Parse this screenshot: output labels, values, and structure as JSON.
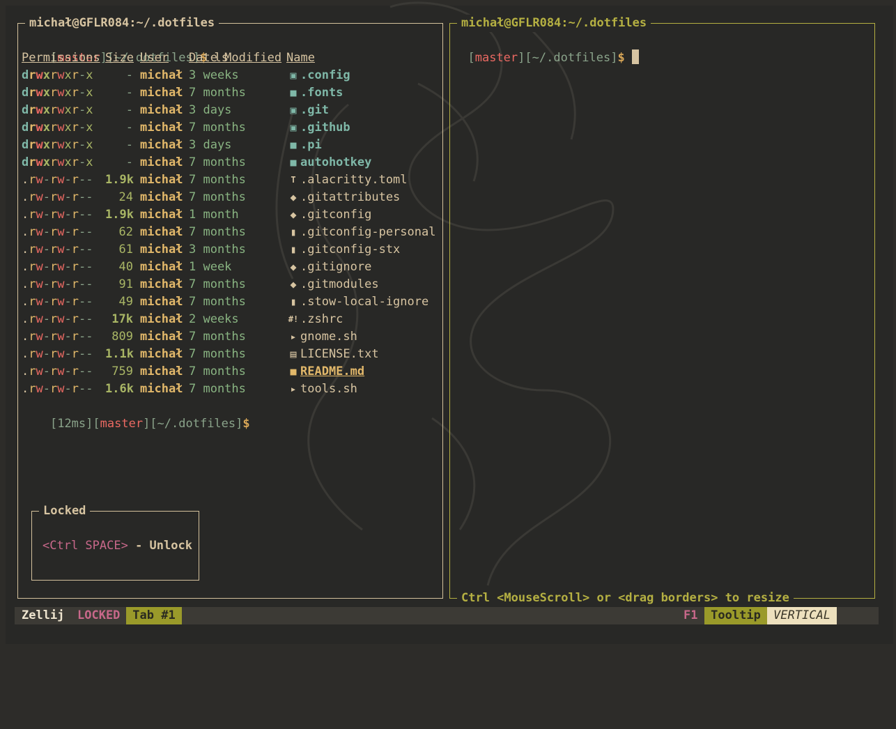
{
  "left_pane": {
    "title": "michał@GFLR084:~/.dotfiles",
    "prompt1": {
      "branch": "master",
      "path": "~/.dotfiles",
      "symbol": "$",
      "command": "ls"
    },
    "headers": [
      "Permissions",
      "Size",
      "User",
      "Date Modified",
      "Name"
    ],
    "rows": [
      {
        "type": "d",
        "perm": "rwxrwxr-x",
        "size": "-",
        "user": "michał",
        "date": "3 weeks",
        "name": ".config",
        "icon": "folder-gear-icon",
        "kind": "dir"
      },
      {
        "type": "d",
        "perm": "rwxrwxr-x",
        "size": "-",
        "user": "michał",
        "date": "7 months",
        "name": ".fonts",
        "icon": "folder-icon",
        "kind": "dir"
      },
      {
        "type": "d",
        "perm": "rwxrwxr-x",
        "size": "-",
        "user": "michał",
        "date": "3 days",
        "name": ".git",
        "icon": "folder-git-icon",
        "kind": "dir"
      },
      {
        "type": "d",
        "perm": "rwxrwxr-x",
        "size": "-",
        "user": "michał",
        "date": "7 months",
        "name": ".github",
        "icon": "folder-github-icon",
        "kind": "dir"
      },
      {
        "type": "d",
        "perm": "rwxrwxr-x",
        "size": "-",
        "user": "michał",
        "date": "3 days",
        "name": ".pi",
        "icon": "folder-icon",
        "kind": "dir"
      },
      {
        "type": "d",
        "perm": "rwxrwxr-x",
        "size": "-",
        "user": "michał",
        "date": "7 months",
        "name": "autohotkey",
        "icon": "folder-icon",
        "kind": "dir"
      },
      {
        "type": ".",
        "perm": "rw-rw-r--",
        "size": "1.9k",
        "user": "michał",
        "date": "7 months",
        "name": ".alacritty.toml",
        "icon": "toml-icon",
        "kind": "file"
      },
      {
        "type": ".",
        "perm": "rw-rw-r--",
        "size": "24",
        "user": "michał",
        "date": "7 months",
        "name": ".gitattributes",
        "icon": "git-icon",
        "kind": "file"
      },
      {
        "type": ".",
        "perm": "rw-rw-r--",
        "size": "1.9k",
        "user": "michał",
        "date": "1 month",
        "name": ".gitconfig",
        "icon": "git-icon",
        "kind": "file"
      },
      {
        "type": ".",
        "perm": "rw-rw-r--",
        "size": "62",
        "user": "michał",
        "date": "7 months",
        "name": ".gitconfig-personal",
        "icon": "file-icon",
        "kind": "file"
      },
      {
        "type": ".",
        "perm": "rw-rw-r--",
        "size": "61",
        "user": "michał",
        "date": "3 months",
        "name": ".gitconfig-stx",
        "icon": "file-icon",
        "kind": "file"
      },
      {
        "type": ".",
        "perm": "rw-rw-r--",
        "size": "40",
        "user": "michał",
        "date": "1 week",
        "name": ".gitignore",
        "icon": "git-icon",
        "kind": "file"
      },
      {
        "type": ".",
        "perm": "rw-rw-r--",
        "size": "91",
        "user": "michał",
        "date": "7 months",
        "name": ".gitmodules",
        "icon": "git-icon",
        "kind": "file"
      },
      {
        "type": ".",
        "perm": "rw-rw-r--",
        "size": "49",
        "user": "michał",
        "date": "7 months",
        "name": ".stow-local-ignore",
        "icon": "file-icon",
        "kind": "file"
      },
      {
        "type": ".",
        "perm": "rw-rw-r--",
        "size": "17k",
        "user": "michał",
        "date": "2 weeks",
        "name": ".zshrc",
        "icon": "shebang-icon",
        "kind": "file"
      },
      {
        "type": ".",
        "perm": "rw-rw-r--",
        "size": "809",
        "user": "michał",
        "date": "7 months",
        "name": "gnome.sh",
        "icon": "terminal-icon",
        "kind": "file"
      },
      {
        "type": ".",
        "perm": "rw-rw-r--",
        "size": "1.1k",
        "user": "michał",
        "date": "7 months",
        "name": "LICENSE.txt",
        "icon": "book-icon",
        "kind": "file"
      },
      {
        "type": ".",
        "perm": "rw-rw-r--",
        "size": "759",
        "user": "michał",
        "date": "7 months",
        "name": "README.md",
        "icon": "readme-icon",
        "kind": "readme"
      },
      {
        "type": ".",
        "perm": "rw-rw-r--",
        "size": "1.6k",
        "user": "michał",
        "date": "7 months",
        "name": "tools.sh",
        "icon": "terminal-icon",
        "kind": "file"
      }
    ],
    "prompt2": {
      "time": "12ms",
      "branch": "master",
      "path": "~/.dotfiles",
      "symbol": "$"
    }
  },
  "locked_popup": {
    "title": "Locked",
    "key": "<Ctrl SPACE>",
    "sep": " - ",
    "action": "Unlock"
  },
  "right_pane": {
    "title": "michał@GFLR084:~/.dotfiles",
    "prompt": {
      "branch": "master",
      "path": "~/.dotfiles",
      "symbol": "$"
    },
    "footer": "Ctrl <MouseScroll> or <drag borders> to resize"
  },
  "status_bar": {
    "app": "Zellij",
    "mode": "LOCKED",
    "tab": "Tab #1",
    "key": "F1",
    "tooltip": "Tooltip",
    "layout": "VERTICAL"
  },
  "colors": {
    "background": "#282826",
    "border": "#d5c29d",
    "focus_border": "#b5b042",
    "branch": "#ea6962",
    "directory": "#7fb8a8",
    "locked": "#c8688a"
  }
}
